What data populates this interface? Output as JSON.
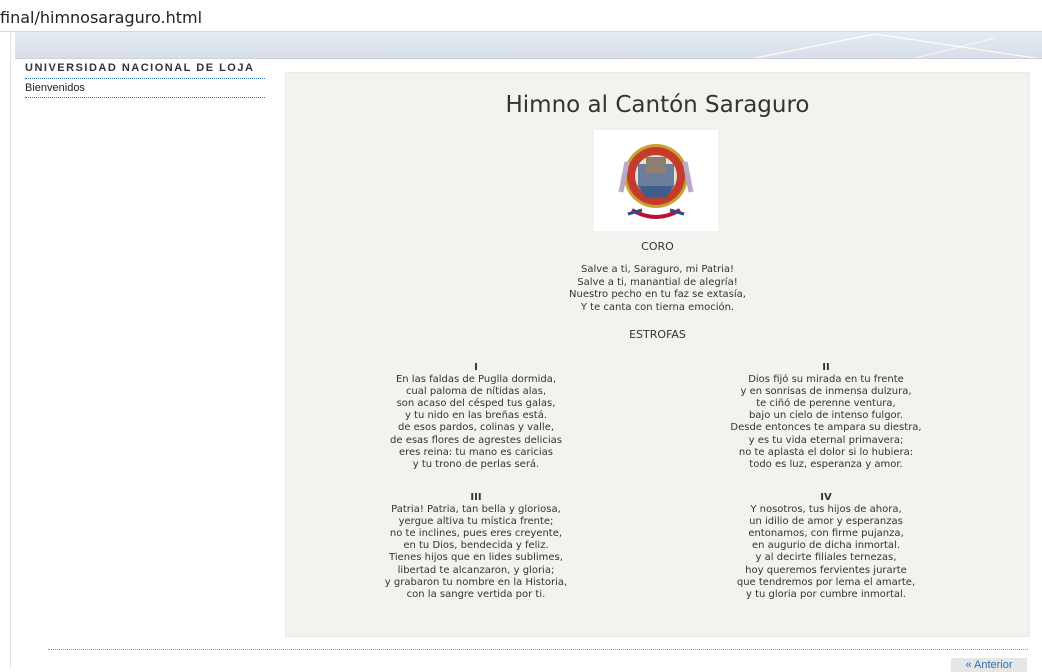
{
  "address_bar": {
    "path": "final/himnosaraguro.html"
  },
  "sidebar": {
    "org_name": "Universidad Nacional de Loja",
    "items": [
      {
        "label": "Bienvenidos"
      }
    ]
  },
  "content": {
    "title": "Himno al Cantón Saraguro",
    "emblem_icon": "coat-of-arms",
    "coro": {
      "heading": "CORO",
      "lines": [
        "Salve a ti, Saraguro, mi Patria!",
        "Salve a ti, manantial de alegría!",
        "Nuestro pecho en tu faz se extasía,",
        "Y te canta con tierna emoción."
      ]
    },
    "estrofas_heading": "ESTROFAS",
    "stanzas": [
      {
        "num": "I",
        "lines": [
          "En las faldas de Puglla dormida,",
          "cual paloma de nítidas alas,",
          "son acaso del césped tus galas,",
          "y tu nido en las breñas está.",
          "de esos pardos, colinas y valle,",
          "de esas flores de agrestes delicias",
          "eres reina: tu mano es caricias",
          "y tu trono de perlas será."
        ]
      },
      {
        "num": "II",
        "lines": [
          "Dios fijó su mirada en tu frente",
          "y en sonrisas de inmensa dulzura,",
          "te ciñó de perenne ventura,",
          "bajo un cielo de intenso fulgor.",
          "Desde entonces te ampara su diestra,",
          "y es tu vida eternal primavera;",
          "no te aplasta el dolor si lo hubiera:",
          "todo es luz, esperanza y amor."
        ]
      },
      {
        "num": "III",
        "lines": [
          "Patria! Patria, tan bella y gloriosa,",
          "yergue altiva tu mística frente;",
          "no te inclines, pues eres creyente,",
          "en tu Dios, bendecida y feliz.",
          "Tienes hijos que en lides sublimes,",
          "libertad te alcanzaron, y gloria;",
          "y grabaron tu nombre en la Historia,",
          "con la sangre vertida por ti."
        ]
      },
      {
        "num": "IV",
        "lines": [
          "Y nosotros, tus hijos de ahora,",
          "un idilio de amor y esperanzas",
          "entonamos, con firme pujanza,",
          "en augurio de dicha inmortal.",
          "y al decirte filiales ternezas,",
          "hoy queremos fervientes jurarte",
          "que tendremos por lema el amarte,",
          "y tu gloria por cumbre inmortal."
        ]
      }
    ]
  },
  "footer": {
    "prev_label": "« Anterior"
  }
}
